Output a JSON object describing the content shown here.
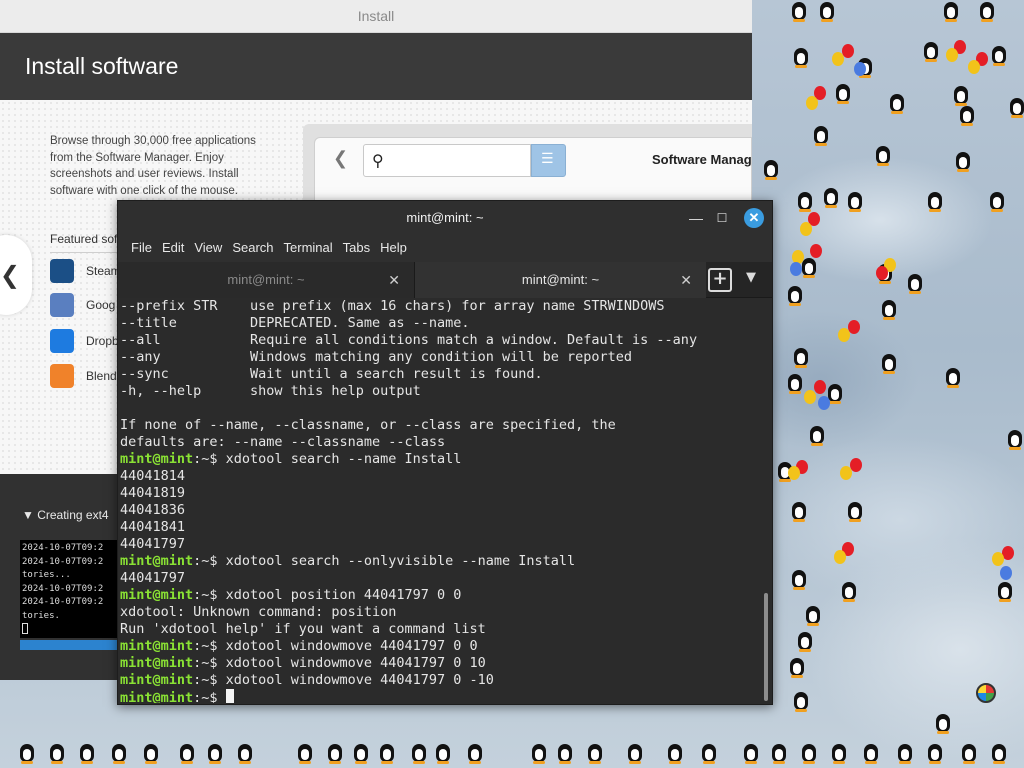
{
  "install": {
    "window_title": "Install",
    "header_title": "Install software",
    "prev_glyph": "❮",
    "description": "Browse through 30,000 free applications from the Software Manager. Enjoy screenshots and user reviews. Install software with one click of the mouse.",
    "featured_title": "Featured sof",
    "featured_apps": [
      {
        "label": "Steam",
        "icon": "steam-icon",
        "color": "#1b4f86"
      },
      {
        "label": "Goog",
        "icon": "google-earth-icon",
        "color": "#5a7fc0"
      },
      {
        "label": "Dropb",
        "icon": "dropbox-icon",
        "color": "#1e7be0"
      },
      {
        "label": "Blend",
        "icon": "blender-icon",
        "color": "#f0822a"
      }
    ],
    "software_manager": {
      "back_glyph": "❮",
      "search_icon": "⚲",
      "search_value": "",
      "list_icon": "☰",
      "title": "Software Manag"
    },
    "progress_label": "▼ Creating ext4",
    "log_lines": [
      "2024-10-07T09:2",
      "2024-10-07T09:2",
      "tories...",
      "2024-10-07T09:2",
      "2024-10-07T09:2",
      "tories."
    ],
    "progress_fraction": 0.13
  },
  "terminal": {
    "title": "mint@mint: ~",
    "min_glyph": "—",
    "max_glyph": "☐",
    "close_glyph": "✕",
    "menu": [
      "File",
      "Edit",
      "View",
      "Search",
      "Terminal",
      "Tabs",
      "Help"
    ],
    "tabs": [
      {
        "label": "mint@mint: ~",
        "close": "✕",
        "active": false
      },
      {
        "label": "mint@mint: ~",
        "close": "✕",
        "active": true
      }
    ],
    "new_tab_glyph": "+",
    "tab_menu_glyph": "▼",
    "prompt": "mint@mint",
    "prompt_suffix": ":~$ ",
    "lines": [
      {
        "text": "--prefix STR    use prefix (max 16 chars) for array name STRWINDOWS"
      },
      {
        "text": "--title         DEPRECATED. Same as --name."
      },
      {
        "text": "--all           Require all conditions match a window. Default is --any"
      },
      {
        "text": "--any           Windows matching any condition will be reported"
      },
      {
        "text": "--sync          Wait until a search result is found."
      },
      {
        "text": "-h, --help      show this help output"
      },
      {
        "text": ""
      },
      {
        "text": "If none of --name, --classname, or --class are specified, the"
      },
      {
        "text": "defaults are: --name --classname --class"
      },
      {
        "prompt": true,
        "text": "xdotool search --name Install"
      },
      {
        "text": "44041814"
      },
      {
        "text": "44041819"
      },
      {
        "text": "44041836"
      },
      {
        "text": "44041841"
      },
      {
        "text": "44041797"
      },
      {
        "prompt": true,
        "text": "xdotool search --onlyvisible --name Install"
      },
      {
        "text": "44041797"
      },
      {
        "prompt": true,
        "text": "xdotool position 44041797 0 0"
      },
      {
        "text": "xdotool: Unknown command: position"
      },
      {
        "text": "Run 'xdotool help' if you want a command list"
      },
      {
        "prompt": true,
        "text": "xdotool windowmove 44041797 0 0"
      },
      {
        "prompt": true,
        "text": "xdotool windowmove 44041797 0 10"
      },
      {
        "prompt": true,
        "text": "xdotool windowmove 44041797 0 -10"
      },
      {
        "prompt": true,
        "text": "",
        "cursor": true
      }
    ]
  },
  "colors": {
    "prompt": "#8ae234",
    "accent": "#3a9ce0"
  }
}
